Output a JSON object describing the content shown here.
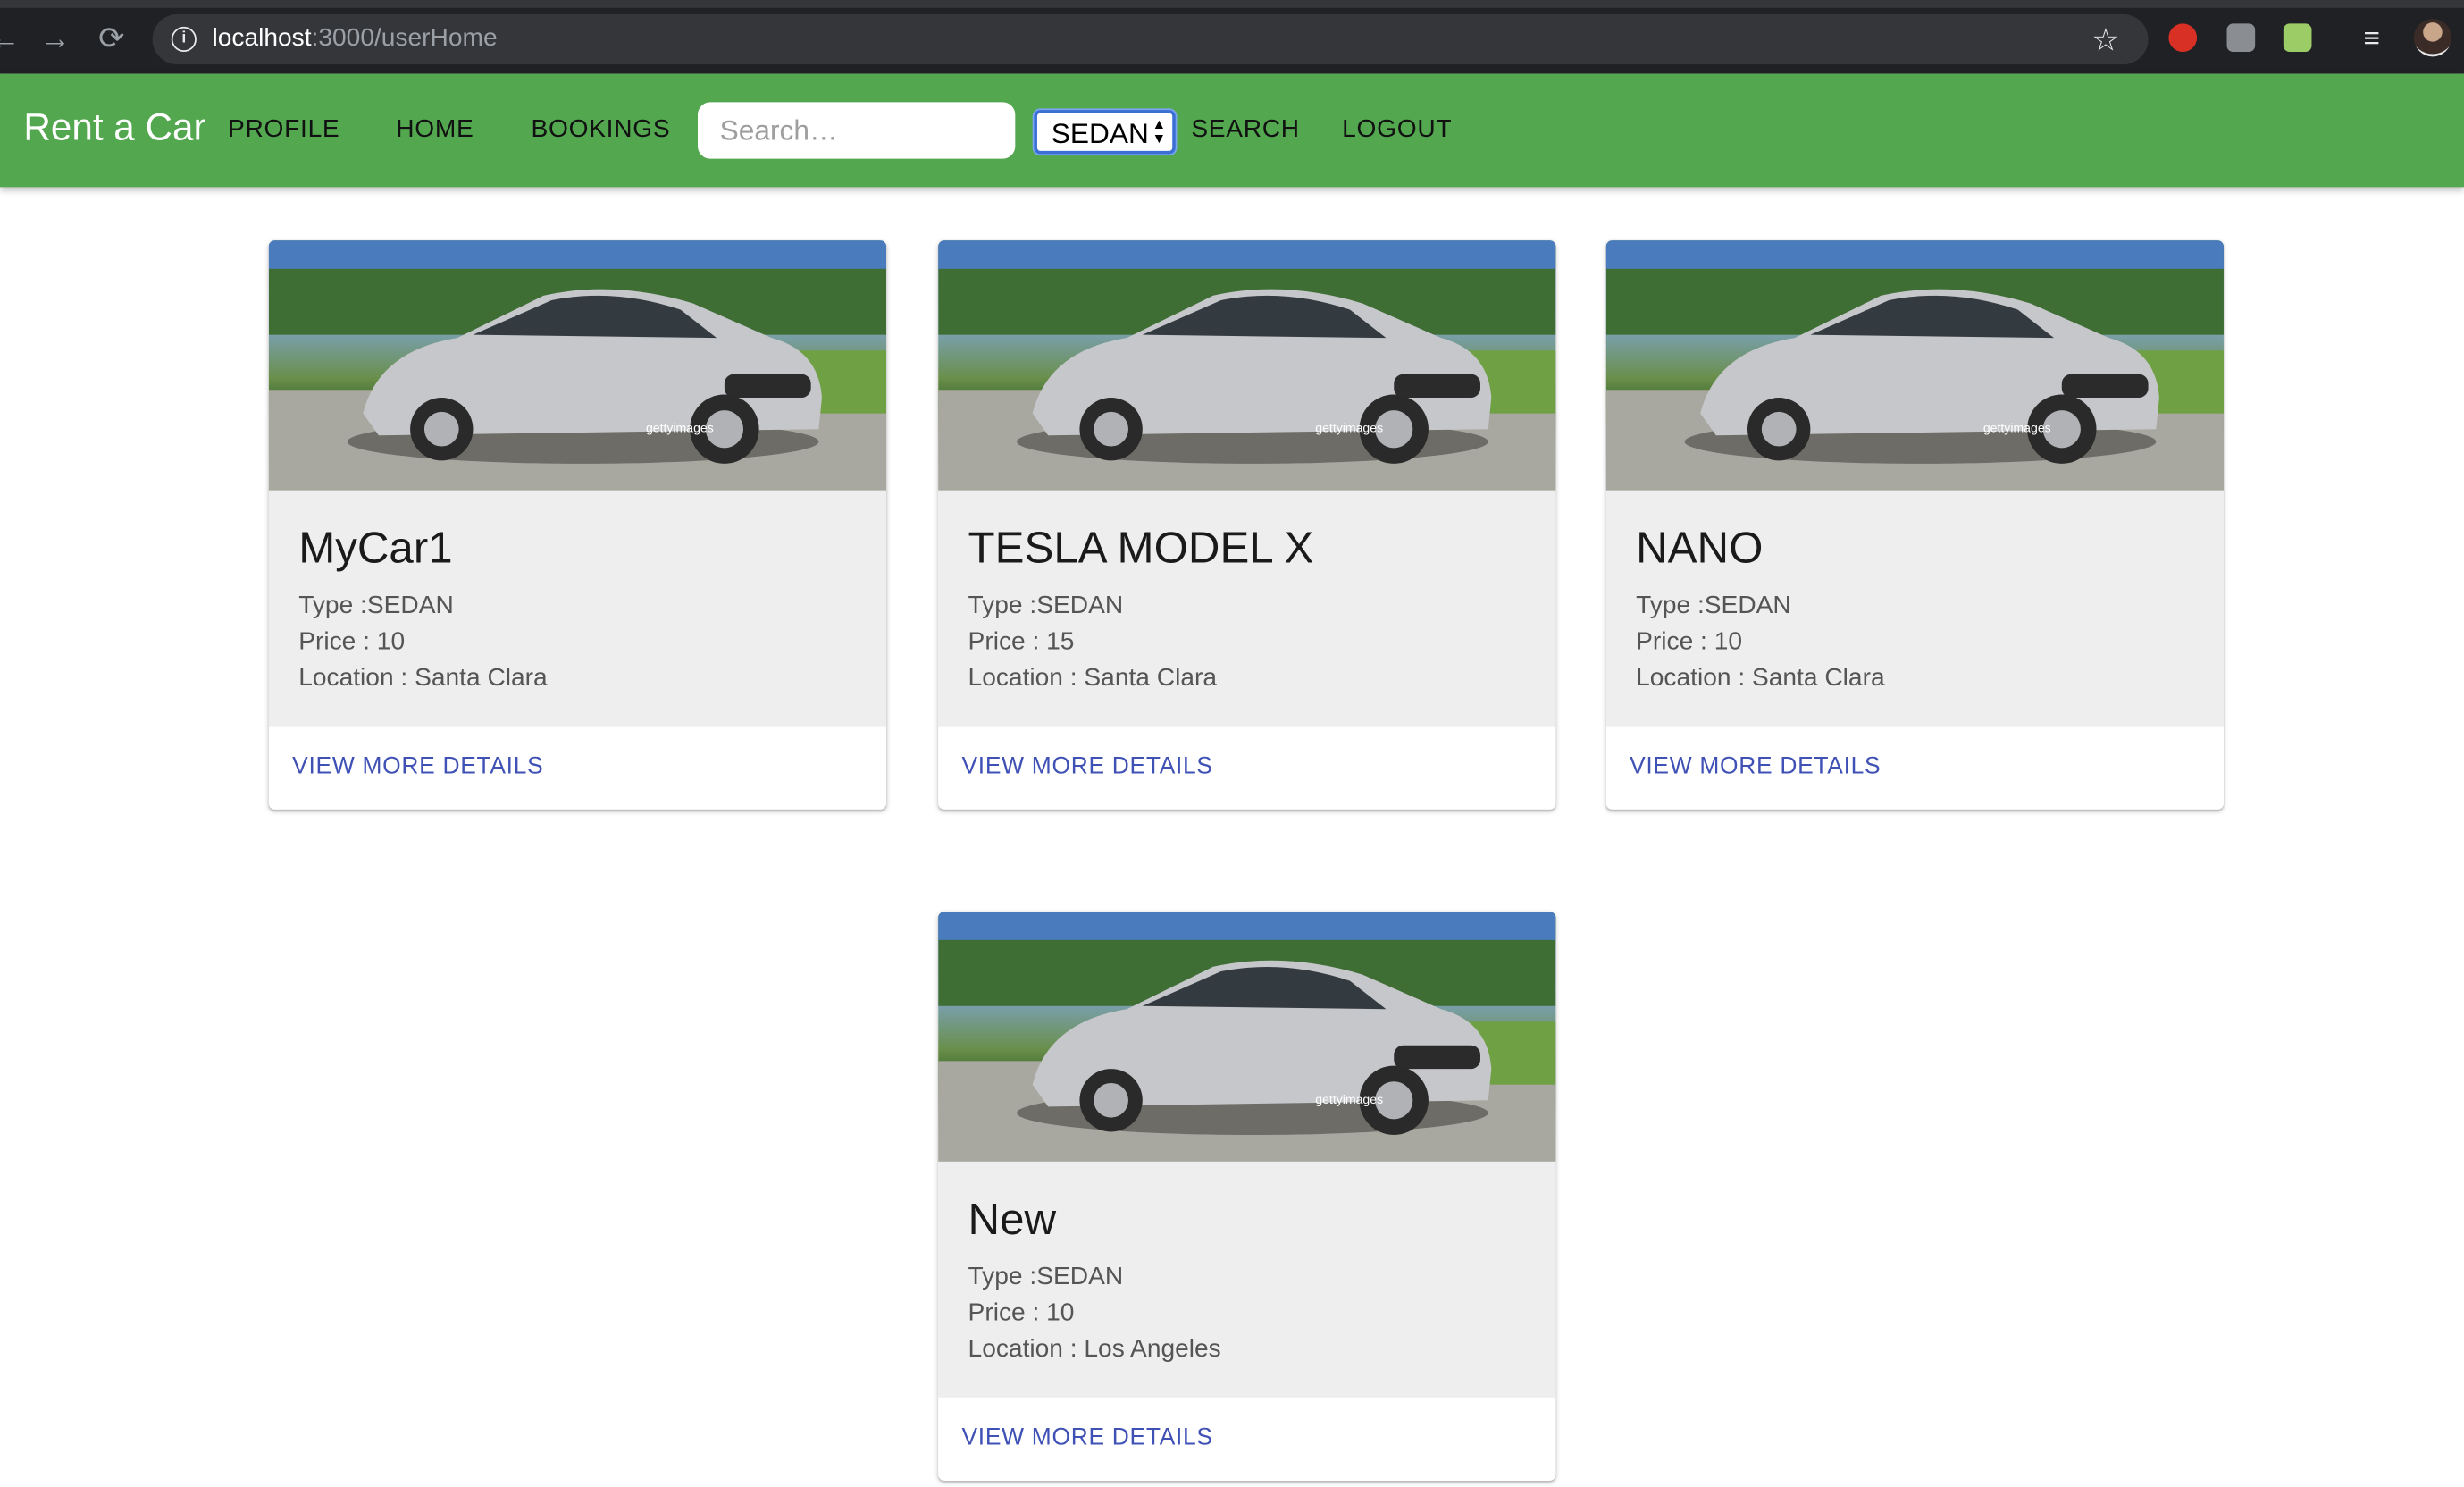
{
  "browser": {
    "url_host": "localhost",
    "url_path": ":3000/userHome"
  },
  "appbar": {
    "brand": "Rent a Car",
    "nav": {
      "profile": "PROFILE",
      "home": "HOME",
      "bookings": "BOOKINGS",
      "search": "SEARCH",
      "logout": "LOGOUT"
    },
    "search_placeholder": "Search…",
    "type_select": {
      "selected": "SEDAN"
    },
    "color": "#52a74f"
  },
  "cards": [
    {
      "title": "MyCar1",
      "type": "Type :SEDAN",
      "price": "Price : 10",
      "location": "Location : Santa Clara",
      "action": "VIEW MORE DETAILS"
    },
    {
      "title": "TESLA MODEL X",
      "type": "Type :SEDAN",
      "price": "Price : 15",
      "location": "Location : Santa Clara",
      "action": "VIEW MORE DETAILS"
    },
    {
      "title": "NANO",
      "type": "Type :SEDAN",
      "price": "Price : 10",
      "location": "Location : Santa Clara",
      "action": "VIEW MORE DETAILS"
    },
    {
      "title": "New",
      "type": "Type :SEDAN",
      "price": "Price : 10",
      "location": "Location : Los Angeles",
      "action": "VIEW MORE DETAILS"
    }
  ],
  "card_image": {
    "watermark": "gettyimages"
  },
  "colors": {
    "accent": "#3f51b5",
    "card_body": "#eeeeee"
  }
}
